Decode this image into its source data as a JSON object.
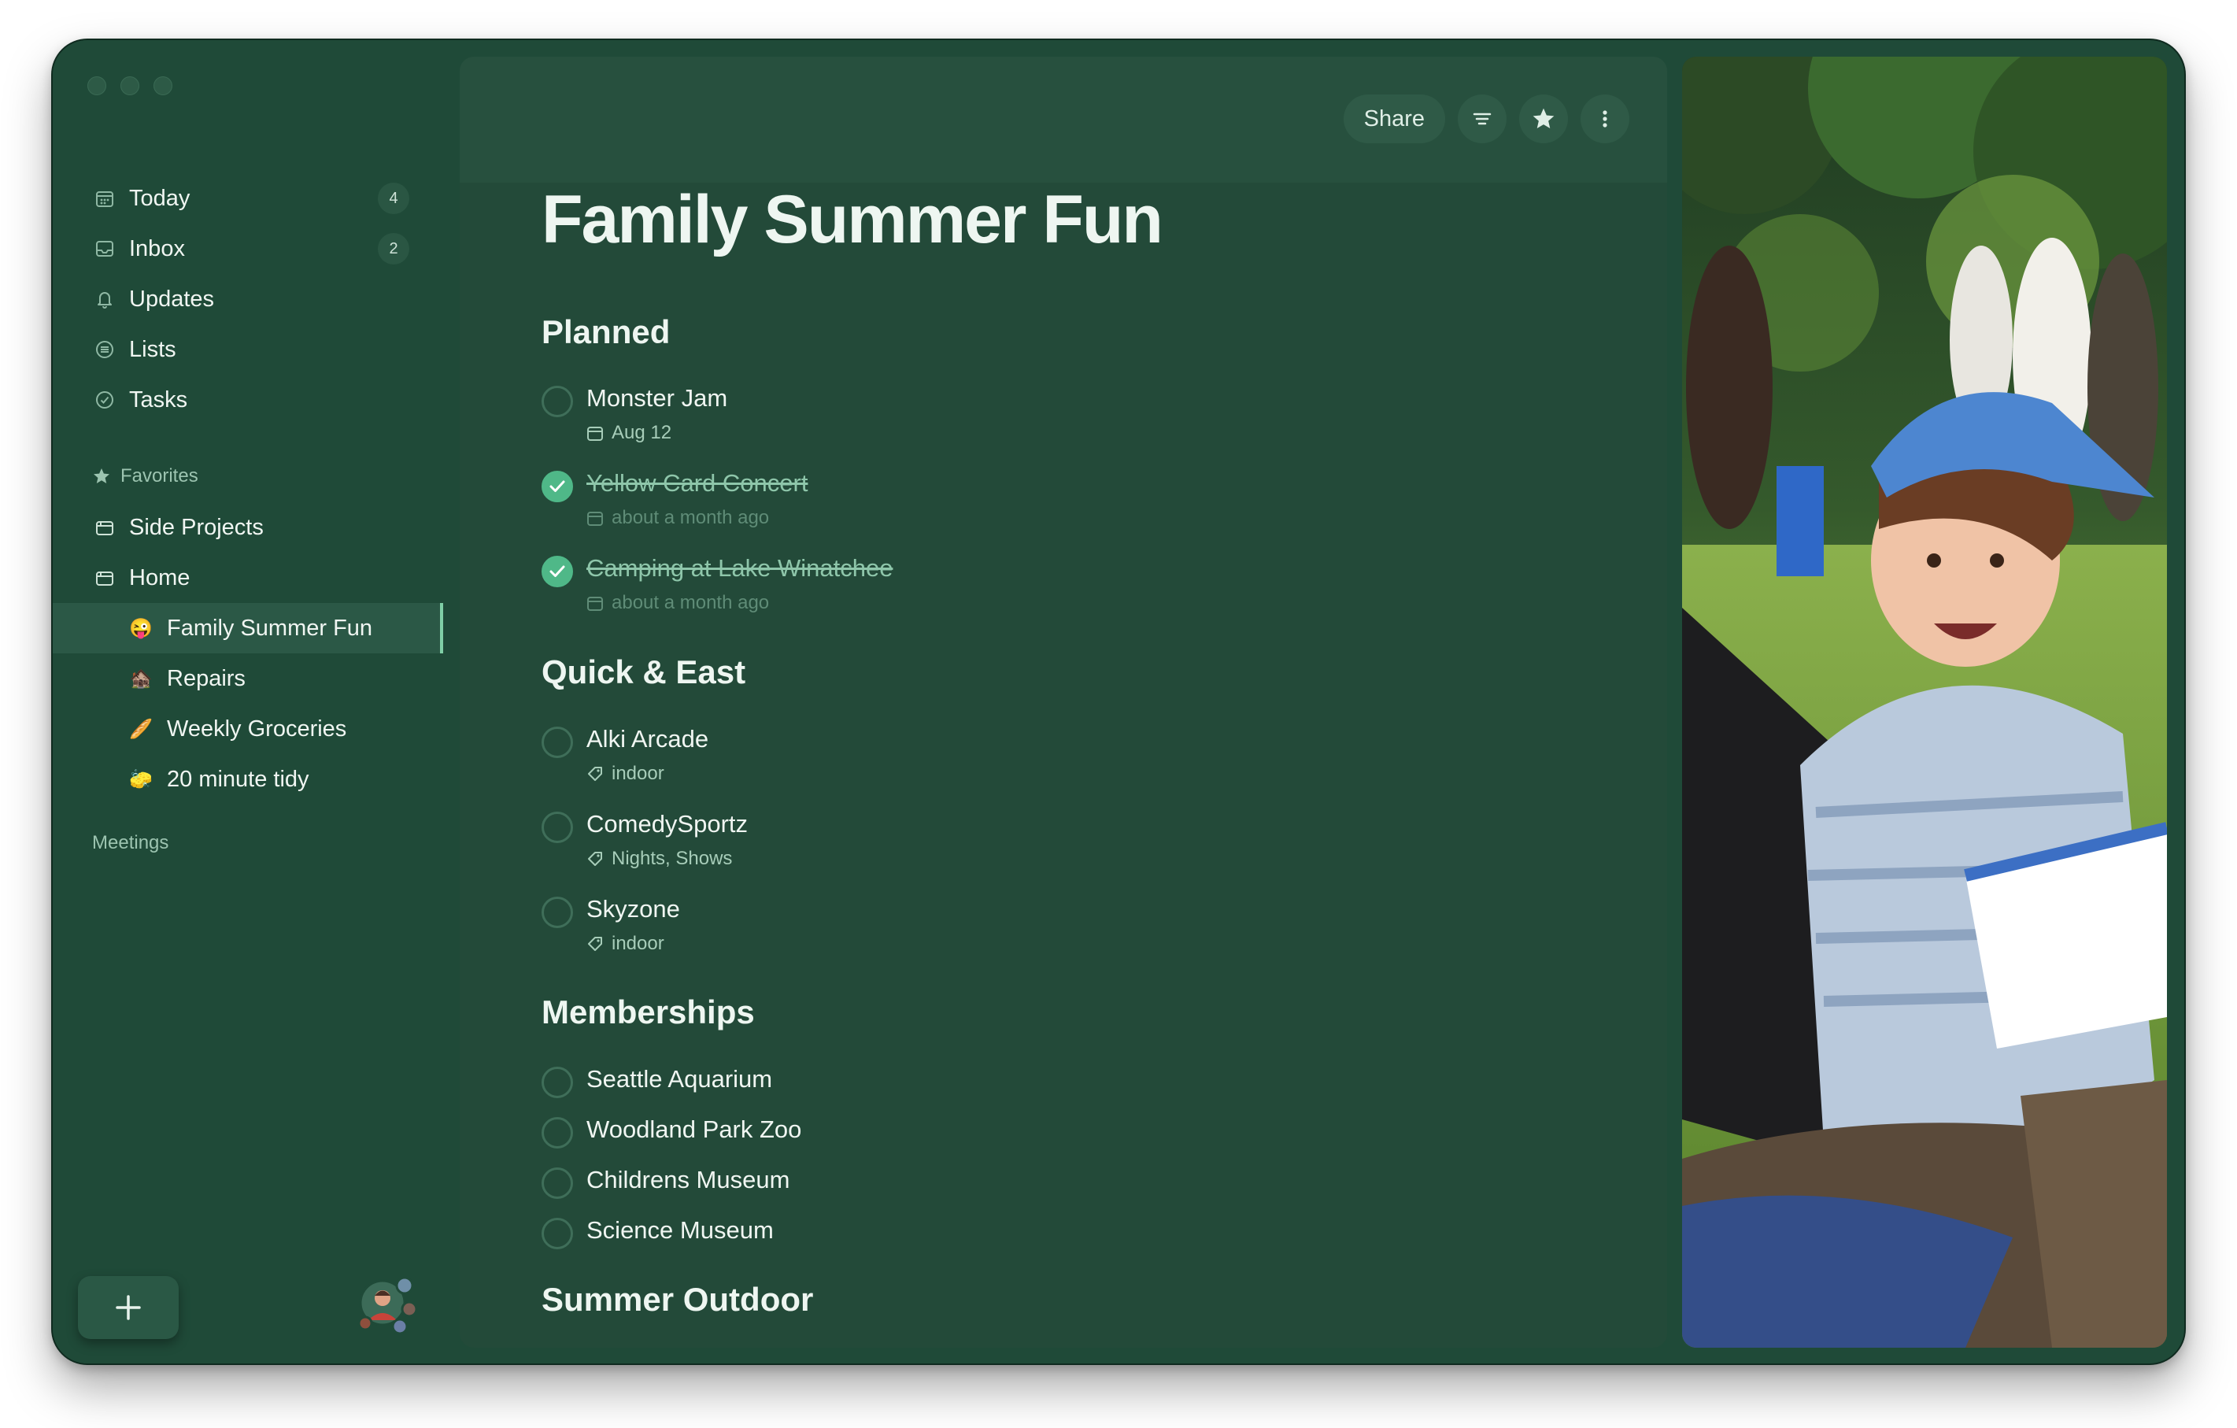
{
  "window": {
    "traffic_lights": [
      "close",
      "minimize",
      "zoom"
    ]
  },
  "sidebar": {
    "top_items": [
      {
        "label": "Today",
        "icon": "calendar-icon",
        "count": "4"
      },
      {
        "label": "Inbox",
        "icon": "inbox-icon",
        "count": "2"
      },
      {
        "label": "Updates",
        "icon": "bell-icon",
        "count": ""
      },
      {
        "label": "Lists",
        "icon": "list-icon",
        "count": ""
      },
      {
        "label": "Tasks",
        "icon": "check-circle-icon",
        "count": ""
      }
    ],
    "favorites_label": "Favorites",
    "favorites": [
      {
        "label": "Side Projects",
        "icon": "folder-icon"
      },
      {
        "label": "Home",
        "icon": "folder-icon"
      }
    ],
    "home_children": [
      {
        "label": "Family Summer Fun",
        "emoji": "😜",
        "active": true
      },
      {
        "label": "Repairs",
        "emoji": "🏚️",
        "active": false
      },
      {
        "label": "Weekly Groceries",
        "emoji": "🥖",
        "active": false
      },
      {
        "label": "20 minute tidy",
        "emoji": "🧽",
        "active": false
      }
    ],
    "meetings_label": "Meetings",
    "add_button_label": "+"
  },
  "toolbar": {
    "share_label": "Share"
  },
  "page": {
    "title": "Family Summer Fun",
    "sections": [
      {
        "title": "Planned",
        "tasks": [
          {
            "name": "Monster Jam",
            "done": false,
            "meta": "Aug 12",
            "meta_icon": "calendar-icon"
          },
          {
            "name": "Yellow Card Concert",
            "done": true,
            "meta": "about a month ago",
            "meta_icon": "calendar-icon"
          },
          {
            "name": "Camping at Lake Winatchee",
            "done": true,
            "meta": "about a month ago",
            "meta_icon": "calendar-icon"
          }
        ]
      },
      {
        "title": "Quick & East",
        "tasks": [
          {
            "name": "Alki Arcade",
            "done": false,
            "meta": "indoor",
            "meta_icon": "tag-icon"
          },
          {
            "name": "ComedySportz",
            "done": false,
            "meta": "Nights, Shows",
            "meta_icon": "tag-icon"
          },
          {
            "name": "Skyzone",
            "done": false,
            "meta": "indoor",
            "meta_icon": "tag-icon"
          }
        ]
      },
      {
        "title": "Memberships",
        "tasks": [
          {
            "name": "Seattle Aquarium",
            "done": false,
            "meta": ""
          },
          {
            "name": "Woodland Park Zoo",
            "done": false,
            "meta": ""
          },
          {
            "name": "Childrens Museum",
            "done": false,
            "meta": ""
          },
          {
            "name": "Science Museum",
            "done": false,
            "meta": ""
          }
        ]
      },
      {
        "title": "Summer Outdoor",
        "tasks": []
      }
    ]
  },
  "colors": {
    "window_bg": "#1f4a38",
    "main_bg": "#234a39",
    "accent_check": "#4fb888",
    "active_item": "#2b5846"
  }
}
